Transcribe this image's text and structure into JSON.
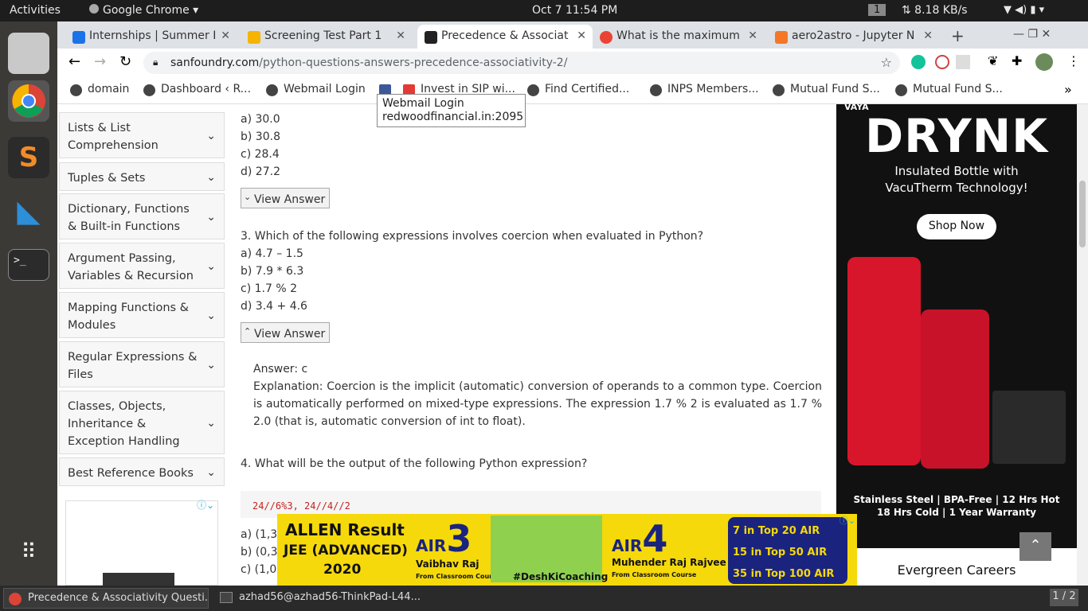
{
  "topbar": {
    "activities": "Activities",
    "app": "Google Chrome",
    "clock": "Oct 7  11:54 PM",
    "workspace": "1",
    "net": "⇅ 8.18 KB/s"
  },
  "tabs": [
    {
      "label": "Internships | Summer I",
      "icon_color": "#1a73e8"
    },
    {
      "label": "Screening Test Part 1",
      "icon_color": "#f4b400"
    },
    {
      "label": "Precedence & Associat",
      "icon_color": "#222222"
    },
    {
      "label": "What is the maximum",
      "icon_color": "#ea4335"
    },
    {
      "label": "aero2astro - Jupyter N",
      "icon_color": "#f37726"
    }
  ],
  "new_tab": "+",
  "url": {
    "host": "sanfoundry.com",
    "path": "/python-questions-answers-precedence-associativity-2/"
  },
  "bookmarks": [
    "domain",
    "Dashboard ‹ R...",
    "Webmail Login",
    "Invest in SIP wi...",
    "Find Certified...",
    "INPS Members...",
    "Mutual Fund S...",
    "Mutual Fund S..."
  ],
  "tooltip": {
    "line1": "Webmail Login",
    "line2": "redwoodfinancial.in:2095"
  },
  "sidebar": [
    "Lists & List Comprehension",
    "Tuples & Sets",
    "Dictionary, Functions & Built-in Functions",
    "Argument Passing, Variables & Recursion",
    "Mapping Functions & Modules",
    "Regular Expressions & Files",
    "Classes, Objects, Inheritance & Exception Handling",
    "Best Reference Books"
  ],
  "q2": {
    "a": "a) 30.0",
    "b": "b) 30.8",
    "c": "c) 28.4",
    "d": "d) 27.2"
  },
  "view_answer": "View Answer",
  "q3": {
    "question": "3. Which of the following expressions involves coercion when evaluated in Python?",
    "a": "a) 4.7 – 1.5",
    "b": "b) 7.9 * 6.3",
    "c": "c) 1.7 % 2",
    "d": "d) 3.4 + 4.6"
  },
  "answer": {
    "label": "Answer: c",
    "explanation": "Explanation: Coercion is the implicit (automatic) conversion of operands to a common type. Coercion is automatically performed on mixed-type expressions. The expression 1.7 % 2 is evaluated as 1.7 % 2.0 (that is, automatic conversion of int to float)."
  },
  "q4": {
    "question": "4. What will be the output of the following Python expression?",
    "code": "24//6%3, 24//4//2",
    "a": "a) (1,3)",
    "b": "b) (0,3)",
    "c": "c) (1,0)"
  },
  "ad_right": {
    "brand": "VAYA",
    "title": "DRYNK",
    "subtitle": "Insulated Bottle with VacuTherm Technology!",
    "cta": "Shop Now",
    "features1": "Stainless Steel  |  BPA-Free  |  12 Hrs Hot",
    "features2": "18 Hrs Cold  |  1 Year Warranty",
    "below": "Evergreen Careers"
  },
  "ad_allen": {
    "brand": "ALLEN",
    "result": "Result",
    "exam": "JEE (ADVANCED)",
    "year": "2020",
    "air1": "3",
    "name1": "Vaibhav Raj",
    "air2": "4",
    "name2": "Muhender Raj Rajvee",
    "course": "From Classroom Course",
    "hashtag": "#DeshKiCoaching",
    "stat1": "7 in Top 20 AIR",
    "stat2": "15 in Top 50 AIR",
    "stat3": "35 in Top 100 AIR"
  },
  "taskbar": {
    "win1": "Precedence & Associativity Questi...",
    "win2": "azhad56@azhad56-ThinkPad-L44...",
    "pager": "1 / 2"
  }
}
